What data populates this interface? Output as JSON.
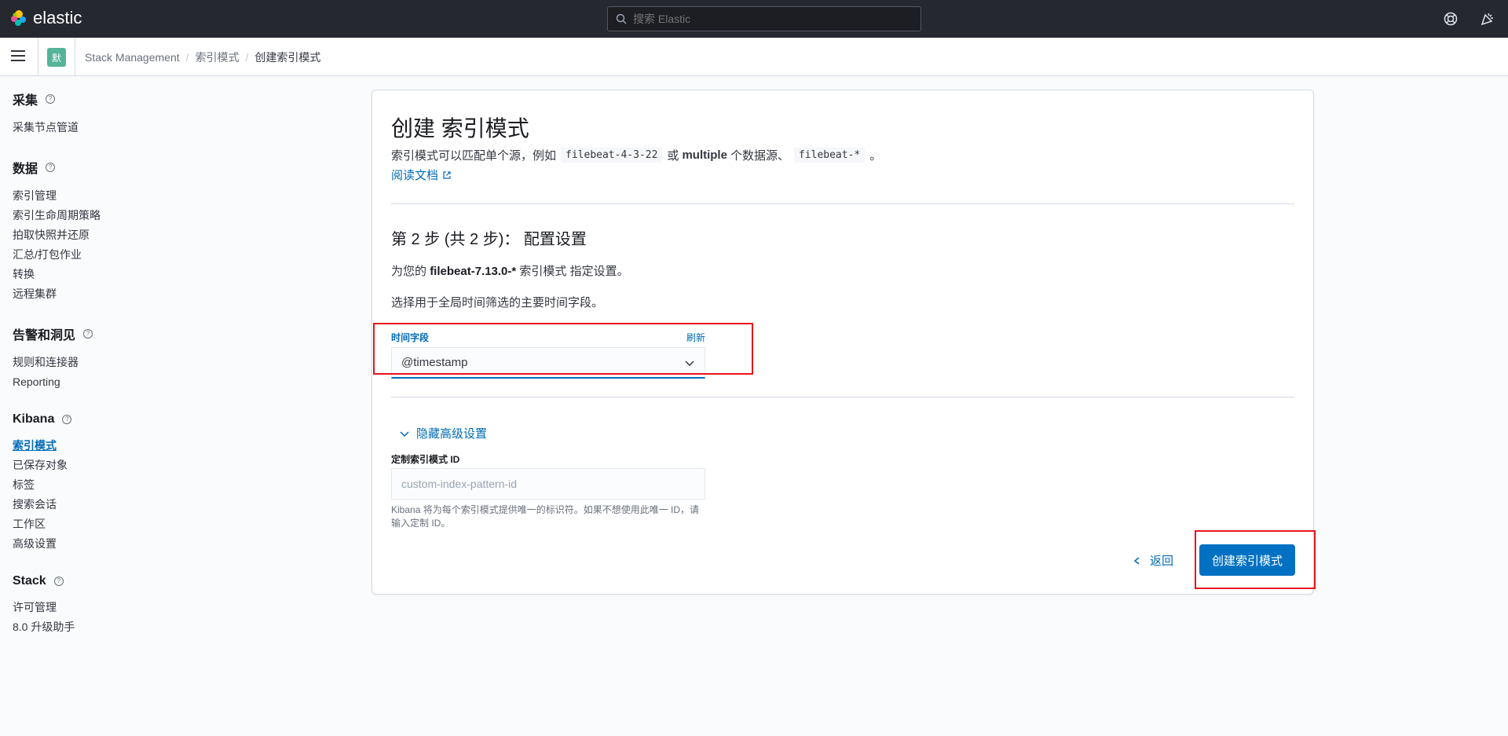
{
  "header": {
    "app_name": "elastic",
    "search_placeholder": "搜索 Elastic"
  },
  "breadcrumbs": {
    "space_badge": "默",
    "items": [
      "Stack Management",
      "索引模式",
      "创建索引模式"
    ]
  },
  "sidebar": {
    "groups": [
      {
        "title": "采集",
        "items": [
          "采集节点管道"
        ]
      },
      {
        "title": "数据",
        "items": [
          "索引管理",
          "索引生命周期策略",
          "拍取快照并还原",
          "汇总/打包作业",
          "转换",
          "远程集群"
        ]
      },
      {
        "title": "告警和洞见",
        "items": [
          "规则和连接器",
          "Reporting"
        ]
      },
      {
        "title": "Kibana",
        "items": [
          "索引模式",
          "已保存对象",
          "标签",
          "搜索会话",
          "工作区",
          "高级设置"
        ]
      },
      {
        "title": "Stack",
        "items": [
          "许可管理",
          "8.0 升级助手"
        ]
      }
    ],
    "active_item": "索引模式"
  },
  "main": {
    "title": "创建 索引模式",
    "desc_prefix": "索引模式可以匹配单个源，例如",
    "code1": "filebeat-4-3-22",
    "desc_or": "或",
    "desc_multiple": "multiple",
    "desc_middle": "个数据源、",
    "code2": "filebeat-*",
    "desc_end": "。",
    "docs_link": "阅读文档",
    "step_title": "第 2 步 (共 2 步)： 配置设置",
    "step_desc_prefix": "为您的",
    "step_pattern": "filebeat-7.13.0-*",
    "step_desc_suffix": "索引模式 指定设置。",
    "select_desc": "选择用于全局时间筛选的主要时间字段。",
    "time_field_label": "时间字段",
    "refresh_label": "刷新",
    "time_field_value": "@timestamp",
    "advanced_toggle": "隐藏高级设置",
    "custom_id_label": "定制索引模式 ID",
    "custom_id_placeholder": "custom-index-pattern-id",
    "custom_id_help": "Kibana 将为每个索引模式提供唯一的标识符。如果不想使用此唯一 ID，请输入定制 ID。",
    "back_label": "返回",
    "create_label": "创建索引模式"
  },
  "colors": {
    "accent": "#006bb8",
    "primary_button": "#0071c2",
    "highlight_border": "#e7151b",
    "header_bg": "#25282f"
  }
}
